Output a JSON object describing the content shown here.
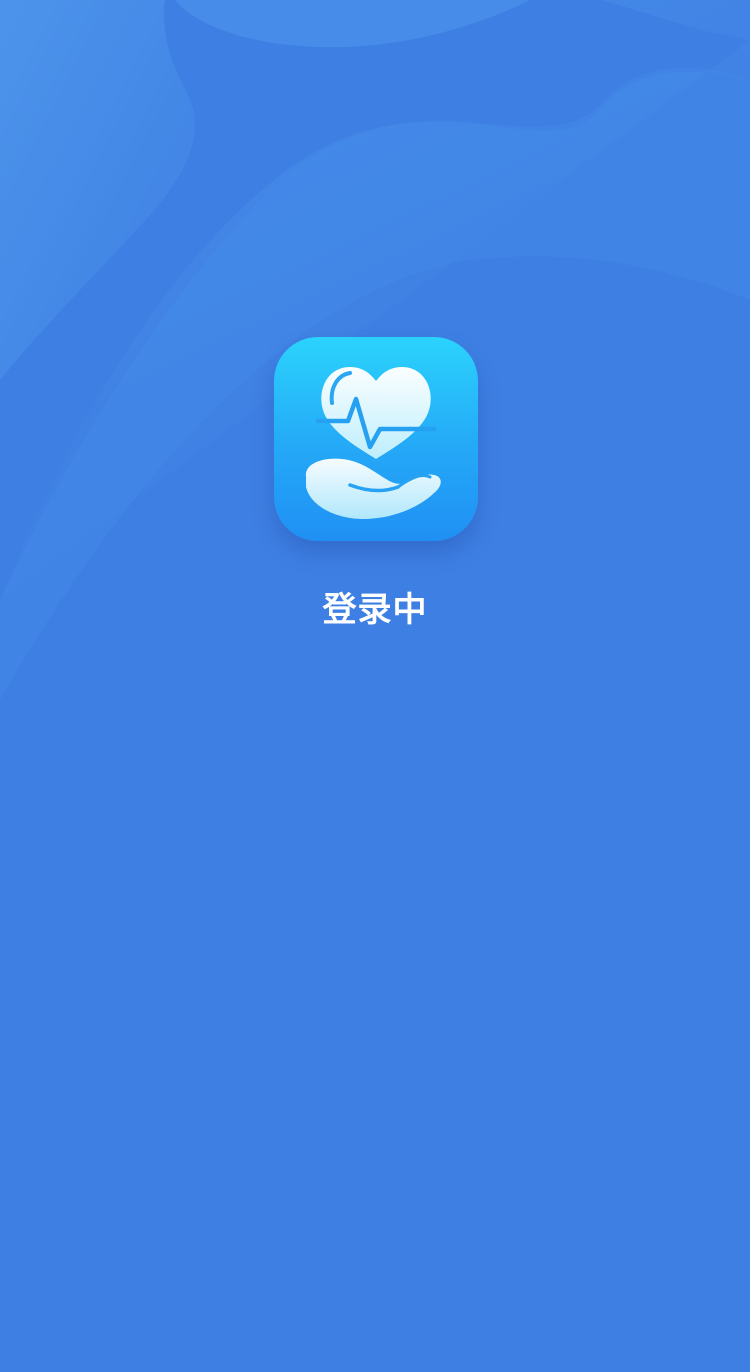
{
  "app": {
    "icon": "heart-pulse-hand-icon"
  },
  "status": {
    "text": "登录中"
  },
  "colors": {
    "background": "#3e7fe3",
    "icon_gradient_top": "#2bd3fc",
    "icon_gradient_bottom": "#2090f4",
    "text": "#ffffff"
  }
}
